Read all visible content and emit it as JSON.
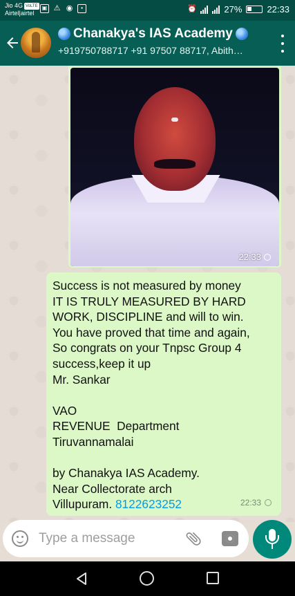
{
  "status_bar": {
    "carrier_line1": "Jio 4G",
    "volte_badge": "VoLTE",
    "carrier_line2": "Airtel|airtel",
    "battery_percent": "27%",
    "time": "22:33"
  },
  "header": {
    "title": "Chanakya's IAS Academy",
    "subtitle": "+919750788717 +91 97507 88717, Abith…"
  },
  "messages": {
    "image_message": {
      "time": "22:33"
    },
    "text_message": {
      "text": "Success is not measured by money\nIT IS TRULY MEASURED BY HARD WORK, DISCIPLINE and will to win.\nYou have proved that time and again,\nSo congrats on your Tnpsc Group 4 success,keep it up\nMr. Sankar\n\nVAO\nREVENUE  Department\nTiruvannamalai\n\nby Chanakya IAS Academy.\nNear Collectorate arch\nVillupuram. ",
      "phone_link": "8122623252",
      "time": "22:33"
    }
  },
  "composer": {
    "placeholder": "Type a message"
  },
  "colors": {
    "header": "#075e54",
    "status_bar": "#054d44",
    "outgoing_bubble": "#dcf8c6",
    "fab": "#00897b",
    "link": "#039be5"
  },
  "icons": {
    "status_left": [
      "gallery-icon",
      "warning-icon",
      "vpn-icon",
      "sim-icon"
    ],
    "status_right": [
      "alarm-icon",
      "signal-icon",
      "signal-icon",
      "battery-icon"
    ],
    "header": [
      "back-arrow-icon",
      "globe-icon",
      "more-vert-icon"
    ],
    "composer": [
      "emoji-icon",
      "attach-icon",
      "camera-icon",
      "mic-icon"
    ],
    "nav": [
      "nav-back-icon",
      "nav-home-icon",
      "nav-recents-icon"
    ]
  }
}
